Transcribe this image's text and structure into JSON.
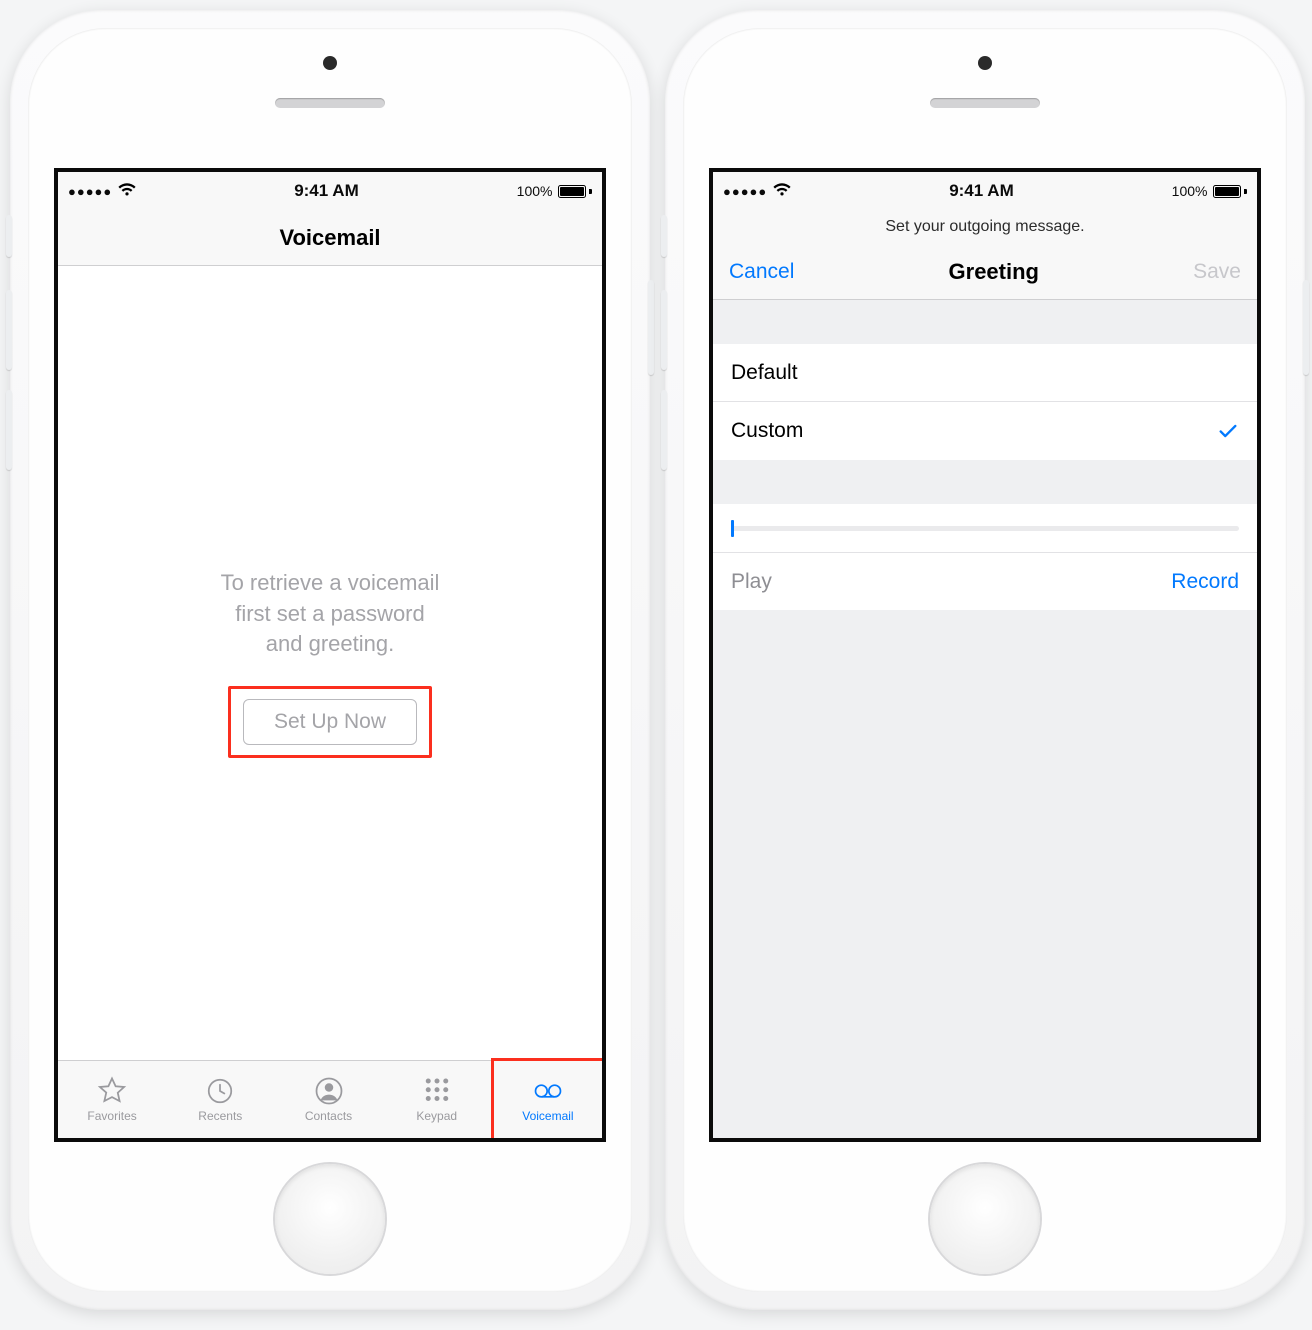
{
  "status": {
    "time": "9:41 AM",
    "battery_pct": "100%"
  },
  "left": {
    "nav_title": "Voicemail",
    "empty": {
      "line1": "To retrieve a voicemail",
      "line2": "first set a password",
      "line3": "and greeting.",
      "button": "Set Up Now"
    },
    "tabs": [
      {
        "label": "Favorites"
      },
      {
        "label": "Recents"
      },
      {
        "label": "Contacts"
      },
      {
        "label": "Keypad"
      },
      {
        "label": "Voicemail"
      }
    ]
  },
  "right": {
    "subheader": "Set your outgoing message.",
    "nav": {
      "cancel": "Cancel",
      "title": "Greeting",
      "save": "Save"
    },
    "options": [
      {
        "label": "Default",
        "selected": false
      },
      {
        "label": "Custom",
        "selected": true
      }
    ],
    "actions": {
      "play": "Play",
      "record": "Record"
    }
  }
}
